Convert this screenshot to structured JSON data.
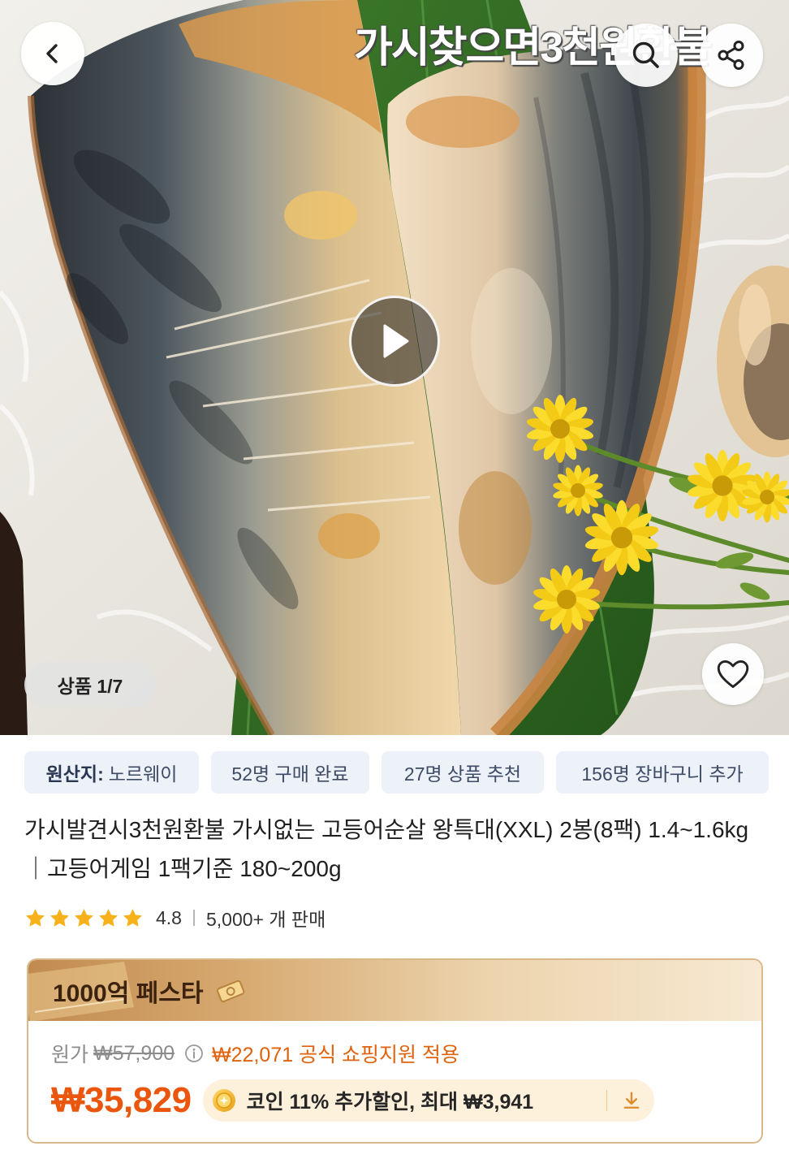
{
  "header": {
    "icons": {
      "back": "chevron-left-icon",
      "search": "search-icon",
      "share": "share-icon"
    }
  },
  "hero": {
    "image_caption": "가시찾으면3천원환불",
    "image_counter": "상품 1/7",
    "icons": {
      "play": "play-icon",
      "wishlist": "heart-icon"
    }
  },
  "tags": [
    {
      "label": "원산지:",
      "value": "노르웨이"
    },
    {
      "label": "52명 구매 완료"
    },
    {
      "label": "27명 상품 추천"
    },
    {
      "label": "156명 장바구니 추가"
    }
  ],
  "product": {
    "title": "가시발견시3천원환불 가시없는 고등어순살 왕특대(XXL) 2봉(8팩) 1.4~1.6kg｜고등어게임 1팩기준 180~200g",
    "rating": {
      "stars_filled": 5,
      "stars_total": 5,
      "score": "4.8",
      "sold": "5,000+ 개 판매"
    }
  },
  "price_box": {
    "event_title": "1000억 페스타",
    "original_label": "원가",
    "original_price": "₩57,900",
    "support_text": "₩22,071 공식 쇼핑지원 적용",
    "sale_price": "₩35,829",
    "coin_offer": "코인 11% 추가할인, 최대 ₩3,941",
    "icons": {
      "event": "ticket-icon",
      "info": "info-icon",
      "coin": "coin-icon",
      "download": "download-icon"
    }
  },
  "colors": {
    "price_accent": "#ea560d",
    "support_text": "#e0620d",
    "star": "#f7b21b",
    "tag_background": "#edf1f8",
    "tag_text": "#3d4b66",
    "festa_border": "#d9b98a",
    "coin_pill_background": "#fdf1db"
  }
}
